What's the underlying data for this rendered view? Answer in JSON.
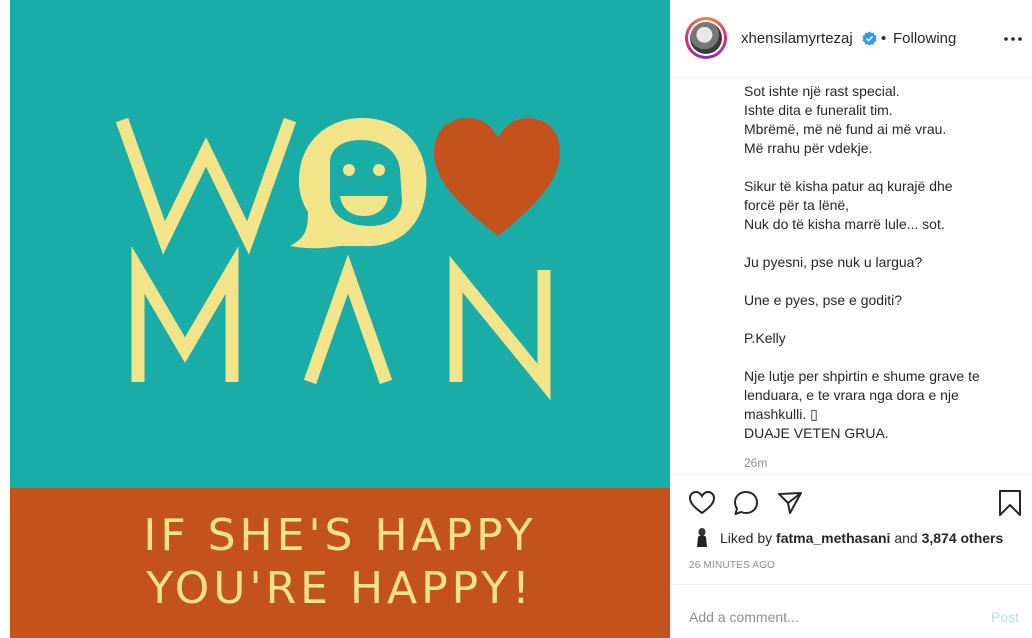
{
  "post": {
    "image": {
      "top_color": "#1aaca6",
      "bottom_color": "#c4521d",
      "art_color": "#f3e48a",
      "heart_color": "#c4521d",
      "letters_row1": "W",
      "letters_row2": "MAN",
      "tagline_line1": "IF SHE'S HAPPY",
      "tagline_line2": "YOU'RE HAPPY!"
    }
  },
  "header": {
    "username": "xhensilamyrtezaj",
    "verified_icon": "verified-badge-icon",
    "separator": "•",
    "follow_status": "Following",
    "more_icon": "more-options-icon"
  },
  "caption": {
    "lines": [
      "Sot ishte një rast special.",
      "Ishte dita e funeralit tim.",
      "Mbrëmë, më në fund ai më vrau.",
      "Më rrahu për vdekje.",
      "",
      "Sikur të kisha patur aq kurajë dhe",
      "forcë për ta lënë,",
      "Nuk do të kisha marrë lule... sot.",
      "",
      "Ju pyesni, pse nuk u largua?",
      "",
      "Une e pyes, pse e goditi?",
      "",
      "P.Kelly",
      "",
      "Nje lutje per shpirtin e shume grave te",
      "lenduara, e te vrara nga dora e nje",
      "mashkulli. ▯",
      "DUAJE VETEN GRUA."
    ],
    "timestamp": "26m"
  },
  "actions": {
    "like_icon": "heart-icon",
    "comment_icon": "comment-icon",
    "share_icon": "share-icon",
    "save_icon": "bookmark-icon"
  },
  "likes": {
    "prefix": "Liked by",
    "user": "fatma_methasani",
    "connector": "and",
    "others": "3,874 others"
  },
  "time_ago": "26 MINUTES AGO",
  "comment": {
    "placeholder": "Add a comment...",
    "post_label": "Post"
  }
}
